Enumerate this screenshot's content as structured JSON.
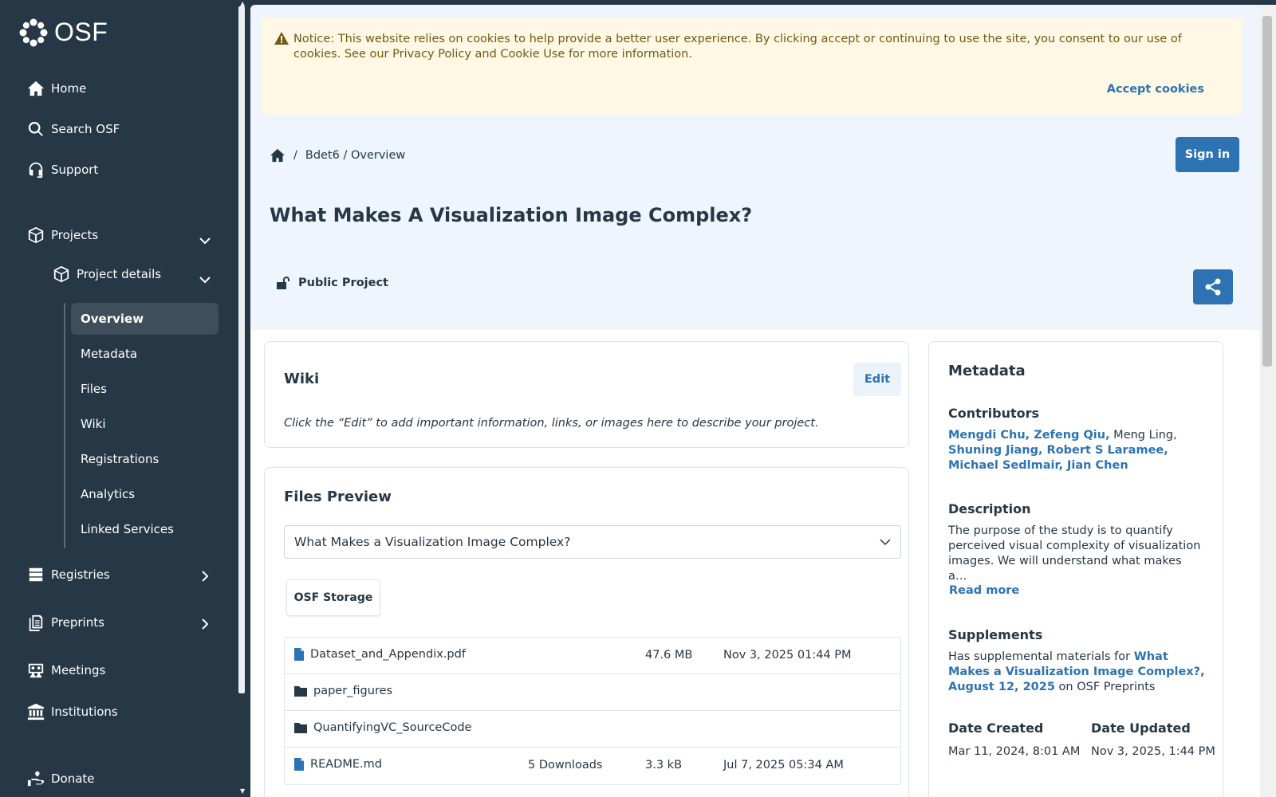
{
  "sidebar": {
    "logo": "OSF",
    "nav": {
      "home": "Home",
      "search": "Search OSF",
      "support": "Support",
      "projects": "Projects",
      "project_details": "Project details",
      "registries": "Registries",
      "preprints": "Preprints",
      "meetings": "Meetings",
      "institutions": "Institutions",
      "donate": "Donate"
    },
    "sub_items": [
      "Overview",
      "Metadata",
      "Files",
      "Wiki",
      "Registrations",
      "Analytics",
      "Linked Services"
    ],
    "active_sub": "Overview"
  },
  "notice": {
    "text": "Notice: This website relies on cookies to help provide a better user experience. By clicking accept or continuing to use the site, you consent to our use of cookies. See our Privacy Policy and Cookie Use for more information.",
    "accept_label": "Accept cookies"
  },
  "breadcrumb": {
    "sep": "/",
    "path": "Bdet6 / Overview"
  },
  "signin_label": "Sign in",
  "title": "What Makes A Visualization Image Complex?",
  "visibility": "Public Project",
  "wiki": {
    "title": "Wiki",
    "edit_label": "Edit",
    "hint": "Click the “Edit” to add important information, links, or images here to describe your project."
  },
  "files": {
    "title": "Files Preview",
    "selected_project": "What Makes a Visualization Image Complex?",
    "storage_label": "OSF Storage",
    "rows": [
      {
        "name": "Dataset_and_Appendix.pdf",
        "type": "file",
        "downloads": "",
        "size": "47.6 MB",
        "date": "Nov 3, 2025 01:44 PM"
      },
      {
        "name": "paper_figures",
        "type": "folder",
        "downloads": "",
        "size": "",
        "date": ""
      },
      {
        "name": "QuantifyingVC_SourceCode",
        "type": "folder",
        "downloads": "",
        "size": "",
        "date": ""
      },
      {
        "name": "README.md",
        "type": "file",
        "downloads": "5 Downloads",
        "size": "3.3 kB",
        "date": "Jul 7, 2025 05:34 AM"
      }
    ]
  },
  "metadata": {
    "title": "Metadata",
    "contributors_label": "Contributors",
    "contributors": {
      "line1_links": "Mengdi Chu, Zefeng Qiu,",
      "line1_plain": " Meng Ling,",
      "line2_links": "Shuning Jiang, Robert S Laramee,",
      "line3_links": "Michael Sedlmair, Jian Chen"
    },
    "description_label": "Description",
    "description": "The purpose of the study is to quantify perceived visual complexity of visualization images. We will understand what makes a…",
    "read_more": "Read more",
    "supplements_label": "Supplements",
    "supplements_prefix": "Has supplemental materials for ",
    "supplements_link": "What Makes a Visualization Image Complex?, August 12, 2025",
    "supplements_suffix": " on OSF Preprints",
    "date_created_label": "Date Created",
    "date_created": "Mar 11, 2024, 8:01 AM",
    "date_updated_label": "Date Updated",
    "date_updated": "Nov 3, 2025, 1:44 PM"
  },
  "colors": {
    "sidebar_bg": "#263746",
    "accent": "#2d73b3",
    "notice_bg": "#fef8e5",
    "hero_bg": "#eef5fc"
  }
}
